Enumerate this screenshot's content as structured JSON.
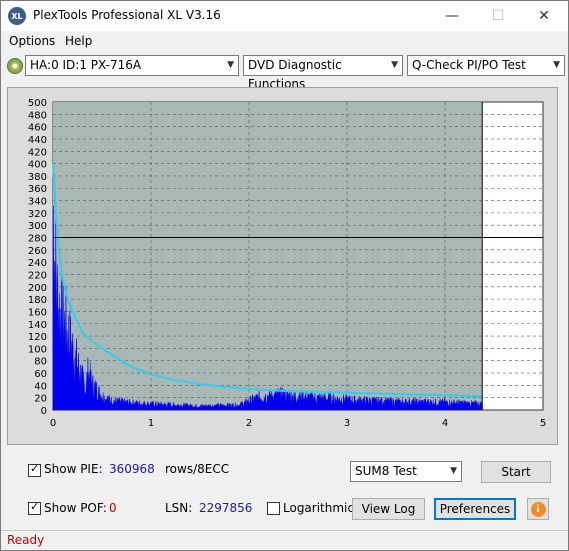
{
  "window": {
    "title": "PlexTools Professional XL V3.16",
    "icon_text": "XL",
    "minimize": "—",
    "maximize": "☐",
    "close": "✕"
  },
  "menu": {
    "items": [
      "Options",
      "Help"
    ]
  },
  "toolbar": {
    "drive": "HA:0 ID:1  PX-716A",
    "function": "DVD Diagnostic Functions",
    "test": "Q-Check PI/PO Test"
  },
  "chart_data": {
    "type": "area",
    "y_ticks": [
      0,
      20,
      40,
      60,
      80,
      100,
      120,
      140,
      160,
      180,
      200,
      220,
      240,
      260,
      280,
      300,
      320,
      340,
      360,
      380,
      400,
      420,
      440,
      460,
      480,
      500
    ],
    "x_ticks": [
      0,
      1,
      2,
      3,
      4,
      5
    ],
    "xlim": [
      0,
      5
    ],
    "ylim": [
      0,
      500
    ],
    "marker_x": 4.38,
    "marker_y": 280,
    "colors": {
      "pie_fill": "#0000ee",
      "sum8_line": "#33ccee",
      "plot_bg": "#ffffff",
      "marker": "#000000"
    },
    "sum8_curve": [
      {
        "x": 0.0,
        "y": 400
      },
      {
        "x": 0.03,
        "y": 320
      },
      {
        "x": 0.06,
        "y": 260
      },
      {
        "x": 0.1,
        "y": 210
      },
      {
        "x": 0.15,
        "y": 180
      },
      {
        "x": 0.2,
        "y": 160
      },
      {
        "x": 0.3,
        "y": 125
      },
      {
        "x": 0.4,
        "y": 112
      },
      {
        "x": 0.5,
        "y": 100
      },
      {
        "x": 0.6,
        "y": 90
      },
      {
        "x": 0.8,
        "y": 70
      },
      {
        "x": 1.0,
        "y": 58
      },
      {
        "x": 1.2,
        "y": 50
      },
      {
        "x": 1.5,
        "y": 42
      },
      {
        "x": 1.8,
        "y": 37
      },
      {
        "x": 2.1,
        "y": 33
      },
      {
        "x": 2.5,
        "y": 30
      },
      {
        "x": 3.0,
        "y": 28
      },
      {
        "x": 3.5,
        "y": 26
      },
      {
        "x": 4.0,
        "y": 24
      },
      {
        "x": 4.38,
        "y": 22
      }
    ],
    "pie_profile": [
      {
        "x": 0.0,
        "y": 410
      },
      {
        "x": 0.02,
        "y": 300
      },
      {
        "x": 0.04,
        "y": 230
      },
      {
        "x": 0.06,
        "y": 200
      },
      {
        "x": 0.1,
        "y": 180
      },
      {
        "x": 0.15,
        "y": 150
      },
      {
        "x": 0.2,
        "y": 120
      },
      {
        "x": 0.25,
        "y": 90
      },
      {
        "x": 0.3,
        "y": 60
      },
      {
        "x": 0.33,
        "y": 40
      },
      {
        "x": 0.36,
        "y": 75
      },
      {
        "x": 0.4,
        "y": 50
      },
      {
        "x": 0.45,
        "y": 40
      },
      {
        "x": 0.5,
        "y": 28
      },
      {
        "x": 0.6,
        "y": 18
      },
      {
        "x": 0.8,
        "y": 14
      },
      {
        "x": 1.0,
        "y": 12
      },
      {
        "x": 1.5,
        "y": 8
      },
      {
        "x": 1.9,
        "y": 10
      },
      {
        "x": 2.1,
        "y": 25
      },
      {
        "x": 2.3,
        "y": 30
      },
      {
        "x": 2.6,
        "y": 25
      },
      {
        "x": 3.0,
        "y": 20
      },
      {
        "x": 3.5,
        "y": 16
      },
      {
        "x": 4.0,
        "y": 15
      },
      {
        "x": 4.38,
        "y": 12
      }
    ]
  },
  "controls": {
    "show_pie_label": "Show PIE:",
    "pie_value": "360968",
    "rows_label": "rows/8ECC",
    "show_pof_label": "Show POF:",
    "pof_value": "0",
    "lsn_label": "LSN:",
    "lsn_value": "2297856",
    "log_label": "Logarithmic",
    "test_select": "SUM8 Test",
    "start": "Start",
    "view_log": "View Log",
    "preferences": "Preferences",
    "info": "i"
  },
  "status": {
    "text": "Ready"
  }
}
